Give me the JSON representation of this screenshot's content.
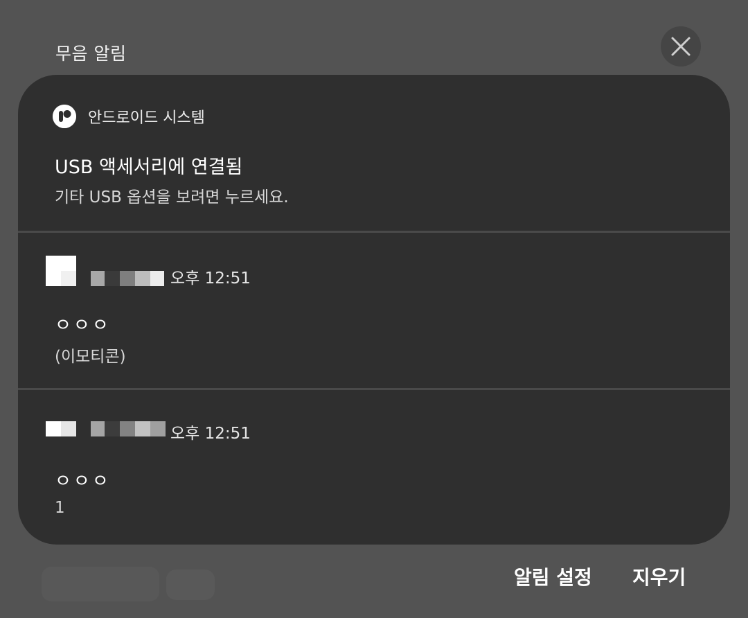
{
  "section": {
    "title": "무음 알림"
  },
  "icons": {
    "close": "close-icon",
    "app": "android-system-icon"
  },
  "colors": {
    "background": "#535353",
    "card": "#2f2f2f",
    "divider": "#4a4a4a",
    "close_button": "#454545"
  },
  "notifications": [
    {
      "app_name": "안드로이드 시스템",
      "title": "USB 액세서리에 연결됨",
      "text": "기타 USB 옵션을 보려면 누르세요."
    },
    {
      "time": "오후 12:51",
      "title": "ㅇㅇㅇ",
      "text": "(이모티콘)"
    },
    {
      "time": "오후 12:51",
      "title": "ㅇㅇㅇ",
      "text": "1"
    }
  ],
  "actions": {
    "settings_label": "알림 설정",
    "clear_label": "지우기"
  }
}
